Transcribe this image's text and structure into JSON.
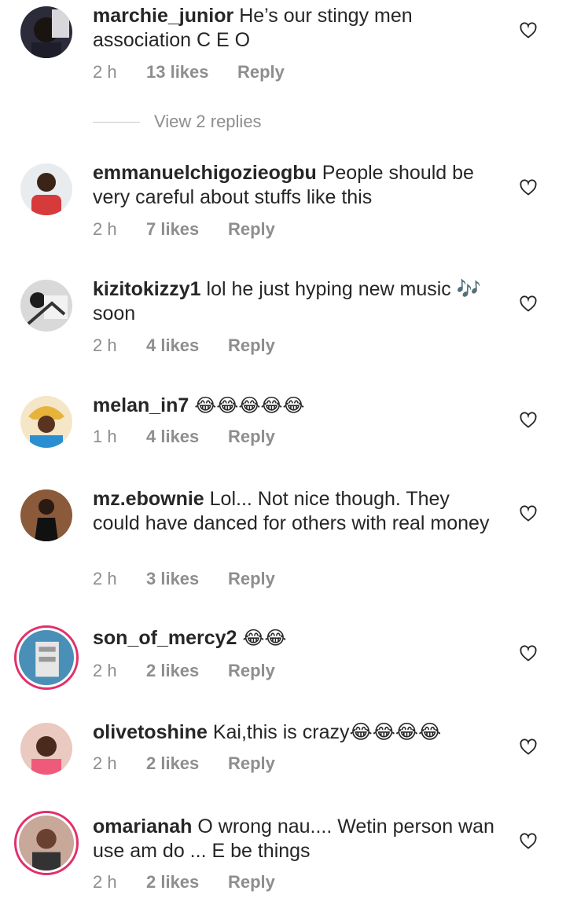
{
  "comments": [
    {
      "username": "marchie_junior",
      "text": "He’s our stingy men association C E O",
      "time": "2 h",
      "likes": "13 likes",
      "reply": "Reply"
    },
    {
      "username": "emmanuelchigozieogbu",
      "text": "People should be very careful about stuffs like this",
      "time": "2 h",
      "likes": "7 likes",
      "reply": "Reply"
    },
    {
      "username": "kizitokizzy1",
      "text": "lol he just hyping new music 🎶 soon",
      "time": "2 h",
      "likes": "4 likes",
      "reply": "Reply"
    },
    {
      "username": "melan_in7",
      "text": "😂😂😂😂😂",
      "time": "1 h",
      "likes": "4 likes",
      "reply": "Reply"
    },
    {
      "username": "mz.ebownie",
      "text": "Lol... Not nice though.  They could have danced for others with real money",
      "time": "2 h",
      "likes": "3 likes",
      "reply": "Reply"
    },
    {
      "username": "son_of_mercy2",
      "text": "😂😂",
      "time": "2 h",
      "likes": "2 likes",
      "reply": "Reply"
    },
    {
      "username": "olivetoshine",
      "text": "Kai,this is crazy😂😂😂😂",
      "time": "2 h",
      "likes": "2 likes",
      "reply": "Reply"
    },
    {
      "username": "omarianah",
      "text": "O wrong nau.... Wetin person wan use am do ... E be things",
      "time": "2 h",
      "likes": "2 likes",
      "reply": "Reply"
    }
  ],
  "view_replies": "View 2 replies",
  "icons": {
    "like": "heart-outline-icon"
  },
  "colors": {
    "text": "#262626",
    "muted": "#8e8e8e",
    "story_ring": "#e1306c"
  }
}
